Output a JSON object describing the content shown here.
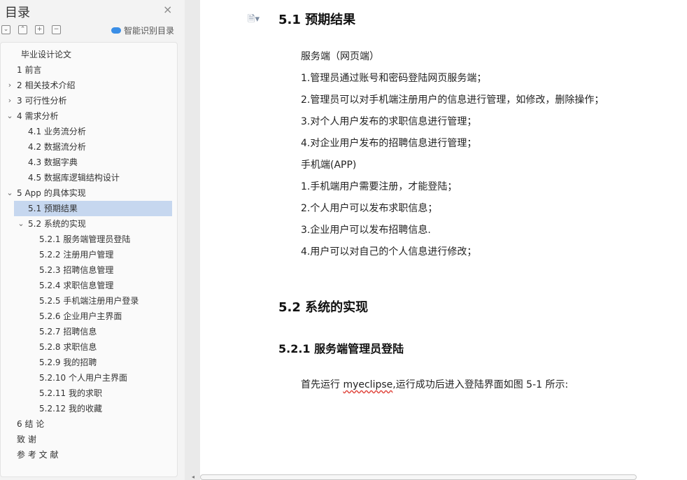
{
  "sidebar": {
    "title": "目录",
    "close_glyph": "×",
    "toolbar": {
      "collapse": "⌄",
      "expand": "⌃",
      "add": "+",
      "remove": "−"
    },
    "ai_label": "智能识别目录",
    "items": [
      {
        "label": "毕业设计论文",
        "level": 0,
        "chev": ""
      },
      {
        "label": "1  前言",
        "level": 1,
        "chev": ""
      },
      {
        "label": "2  相关技术介绍",
        "level": 1,
        "chev": "›"
      },
      {
        "label": "3  可行性分析",
        "level": 1,
        "chev": "›"
      },
      {
        "label": "4  需求分析",
        "level": 1,
        "chev": "⌄"
      },
      {
        "label": "4.1  业务流分析",
        "level": 2,
        "chev": ""
      },
      {
        "label": "4.2    数据流分析",
        "level": 2,
        "chev": ""
      },
      {
        "label": "4.3    数据字典",
        "level": 2,
        "chev": ""
      },
      {
        "label": "4.5  数据库逻辑结构设计",
        "level": 2,
        "chev": ""
      },
      {
        "label": "5 App 的具体实现",
        "level": 1,
        "chev": "⌄"
      },
      {
        "label": "5.1 预期结果",
        "level": 2,
        "chev": "",
        "active": true
      },
      {
        "label": "5.2  系统的实现",
        "level": 2,
        "chev": "⌄"
      },
      {
        "label": "5.2.1  服务端管理员登陆",
        "level": 3,
        "chev": ""
      },
      {
        "label": "5.2.2  注册用户管理",
        "level": 3,
        "chev": ""
      },
      {
        "label": "5.2.3  招聘信息管理",
        "level": 3,
        "chev": ""
      },
      {
        "label": "5.2.4  求职信息管理",
        "level": 3,
        "chev": ""
      },
      {
        "label": "5.2.5  手机端注册用户登录",
        "level": 3,
        "chev": ""
      },
      {
        "label": "5.2.6  企业用户主界面",
        "level": 3,
        "chev": ""
      },
      {
        "label": "5.2.7  招聘信息",
        "level": 3,
        "chev": ""
      },
      {
        "label": "5.2.8  求职信息",
        "level": 3,
        "chev": ""
      },
      {
        "label": "5.2.9  我的招聘",
        "level": 3,
        "chev": ""
      },
      {
        "label": "5.2.10  个人用户主界面",
        "level": 3,
        "chev": ""
      },
      {
        "label": "5.2.11  我的求职",
        "level": 3,
        "chev": ""
      },
      {
        "label": "5.2.12  我的收藏",
        "level": 3,
        "chev": ""
      },
      {
        "label": "6   结  论",
        "level": 1,
        "chev": ""
      },
      {
        "label": "致   谢",
        "level": 1,
        "chev": ""
      },
      {
        "label": "参  考  文  献",
        "level": 1,
        "chev": ""
      }
    ]
  },
  "document": {
    "doc_icon": "🗎▾",
    "heading_1": "5.1 预期结果",
    "server_lines": [
      "服务端（网页端）",
      "1.管理员通过账号和密码登陆网页服务端；",
      "2.管理员可以对手机端注册用户的信息进行管理，如修改，删除操作；",
      "3.对个人用户发布的求职信息进行管理；",
      "4.对企业用户发布的招聘信息进行管理；",
      "手机端(APP)",
      "1.手机端用户需要注册，才能登陆；",
      "2.个人用户可以发布求职信息；",
      "3.企业用户可以发布招聘信息.",
      "4.用户可以对自己的个人信息进行修改；"
    ],
    "heading_2": "5.2  系统的实现",
    "heading_3": "5.2.1  服务端管理员登陆",
    "para_prefix": "首先运行 ",
    "para_word": "myeclipse",
    "para_suffix": ",运行成功后进入登陆界面如图 5-1 所示:"
  },
  "scrollbar": {
    "left_arrow": "◂"
  }
}
